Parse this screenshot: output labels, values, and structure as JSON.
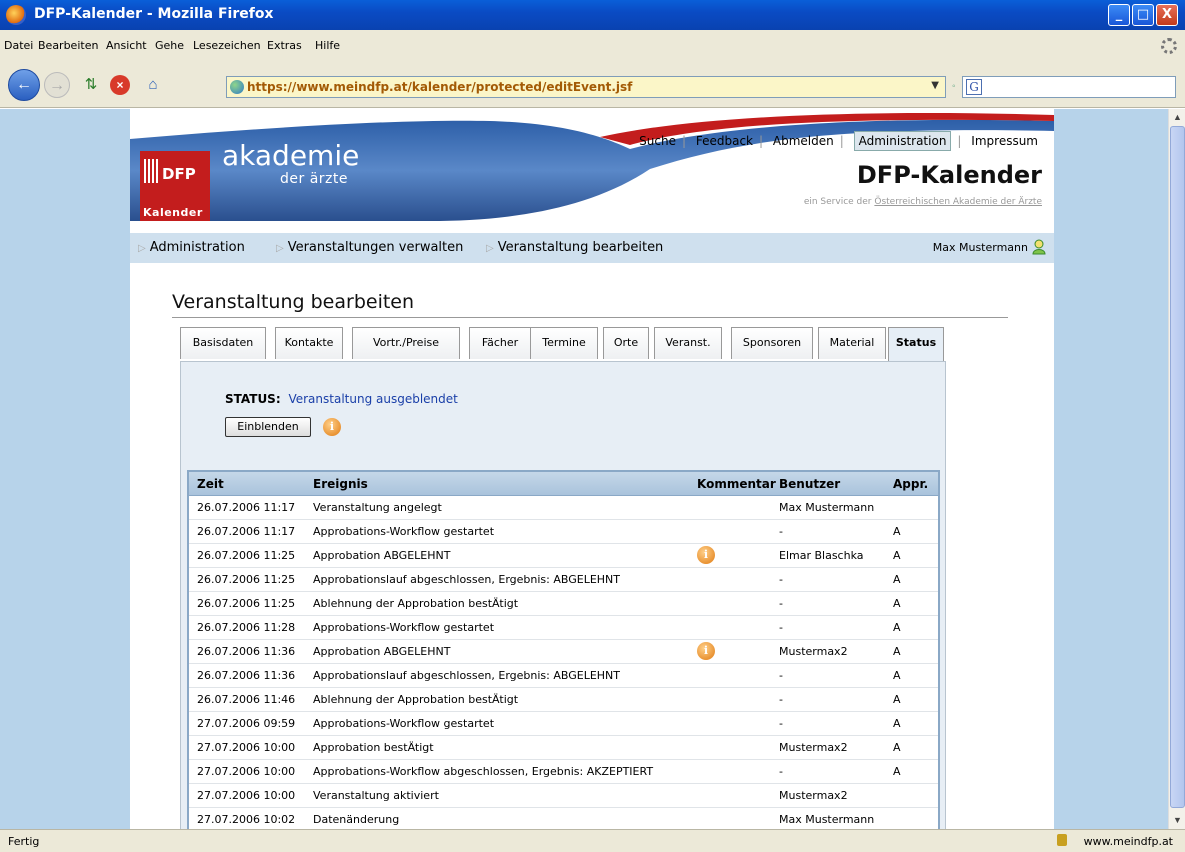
{
  "window": {
    "title": "DFP-Kalender - Mozilla Firefox",
    "min": "_",
    "max": "□",
    "close": "X"
  },
  "menu": [
    "Datei",
    "Bearbeiten",
    "Ansicht",
    "Gehe",
    "Lesezeichen",
    "Extras",
    "Hilfe"
  ],
  "nav": {
    "url": "https://www.meindfp.at/kalender/protected/editEvent.jsf",
    "search_engine": "G"
  },
  "header": {
    "logo_dfp": "DFP",
    "logo_kalender": "Kalender",
    "logo_akademie": "akademie",
    "logo_der_aerzte": "der ärzte",
    "links": [
      "Suche",
      "Feedback",
      "Abmelden",
      "Administration",
      "Impressum"
    ],
    "brand": "DFP-Kalender",
    "service_prefix": "ein Service der",
    "service_link": "Österreichischen Akademie der Ärzte"
  },
  "breadcrumb": [
    "Administration",
    "Veranstaltungen verwalten",
    "Veranstaltung bearbeiten"
  ],
  "user": "Max Mustermann",
  "page_title": "Veranstaltung bearbeiten",
  "tabs": [
    "Basisdaten",
    "Kontakte",
    "Vortr./Preise",
    "Fächer",
    "Termine",
    "Orte",
    "Veranst.",
    "Sponsoren",
    "Material",
    "Status"
  ],
  "active_tab": "Status",
  "status": {
    "label": "STATUS:",
    "value": "Veranstaltung ausgeblendet",
    "button": "Einblenden"
  },
  "table": {
    "headers": [
      "Zeit",
      "Ereignis",
      "Kommentar",
      "Benutzer",
      "Appr."
    ],
    "rows": [
      {
        "zeit": "26.07.2006 11:17",
        "ereignis": "Veranstaltung angelegt",
        "kommentar": false,
        "benutzer": "Max Mustermann",
        "appr": ""
      },
      {
        "zeit": "26.07.2006 11:17",
        "ereignis": "Approbations-Workflow gestartet",
        "kommentar": false,
        "benutzer": "-",
        "appr": "A"
      },
      {
        "zeit": "26.07.2006 11:25",
        "ereignis": "Approbation ABGELEHNT",
        "kommentar": true,
        "benutzer": "Elmar Blaschka",
        "appr": "A"
      },
      {
        "zeit": "26.07.2006 11:25",
        "ereignis": "Approbationslauf abgeschlossen, Ergebnis: ABGELEHNT",
        "kommentar": false,
        "benutzer": "-",
        "appr": "A"
      },
      {
        "zeit": "26.07.2006 11:25",
        "ereignis": "Ablehnung der Approbation bestÄtigt",
        "kommentar": false,
        "benutzer": "-",
        "appr": "A"
      },
      {
        "zeit": "26.07.2006 11:28",
        "ereignis": "Approbations-Workflow gestartet",
        "kommentar": false,
        "benutzer": "-",
        "appr": "A"
      },
      {
        "zeit": "26.07.2006 11:36",
        "ereignis": "Approbation ABGELEHNT",
        "kommentar": true,
        "benutzer": "Mustermax2",
        "appr": "A"
      },
      {
        "zeit": "26.07.2006 11:36",
        "ereignis": "Approbationslauf abgeschlossen, Ergebnis: ABGELEHNT",
        "kommentar": false,
        "benutzer": "-",
        "appr": "A"
      },
      {
        "zeit": "26.07.2006 11:46",
        "ereignis": "Ablehnung der Approbation bestÄtigt",
        "kommentar": false,
        "benutzer": "-",
        "appr": "A"
      },
      {
        "zeit": "27.07.2006 09:59",
        "ereignis": "Approbations-Workflow gestartet",
        "kommentar": false,
        "benutzer": "-",
        "appr": "A"
      },
      {
        "zeit": "27.07.2006 10:00",
        "ereignis": "Approbation bestÄtigt",
        "kommentar": false,
        "benutzer": "Mustermax2",
        "appr": "A"
      },
      {
        "zeit": "27.07.2006 10:00",
        "ereignis": "Approbations-Workflow abgeschlossen, Ergebnis: AKZEPTIERT",
        "kommentar": false,
        "benutzer": "-",
        "appr": "A"
      },
      {
        "zeit": "27.07.2006 10:00",
        "ereignis": "Veranstaltung aktiviert",
        "kommentar": false,
        "benutzer": "Mustermax2",
        "appr": ""
      },
      {
        "zeit": "27.07.2006 10:02",
        "ereignis": "Datenänderung",
        "kommentar": false,
        "benutzer": "Max Mustermann",
        "appr": ""
      }
    ]
  },
  "statusbar": {
    "text": "Fertig",
    "host": "www.meindfp.at"
  }
}
